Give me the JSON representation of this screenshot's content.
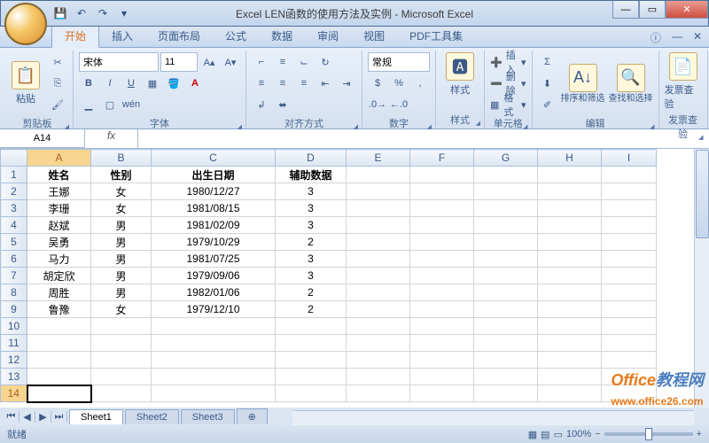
{
  "window": {
    "title": "Excel LEN函数的使用方法及实例 - Microsoft Excel"
  },
  "tabs": [
    "开始",
    "插入",
    "页面布局",
    "公式",
    "数据",
    "审阅",
    "视图",
    "PDF工具集"
  ],
  "active_tab_index": 0,
  "ribbon": {
    "clipboard": {
      "paste": "粘贴",
      "label": "剪贴板"
    },
    "font": {
      "name": "宋体",
      "size": "11",
      "label": "字体"
    },
    "align": {
      "label": "对齐方式"
    },
    "number": {
      "format": "常规",
      "label": "数字"
    },
    "styles": {
      "label": "样式",
      "btn": "样式"
    },
    "cells": {
      "insert": "插入",
      "delete": "删除",
      "format": "格式",
      "label": "单元格"
    },
    "editing": {
      "sort": "排序和筛选",
      "find": "查找和选择",
      "label": "编辑"
    },
    "invoice": {
      "btn": "发票查验",
      "label": "发票查验"
    }
  },
  "name_box": "A14",
  "formula": "",
  "columns": [
    "A",
    "B",
    "C",
    "D",
    "E",
    "F",
    "G",
    "H",
    "I"
  ],
  "rows": [
    {
      "n": 1,
      "A": "姓名",
      "B": "性别",
      "C": "出生日期",
      "D": "辅助数据",
      "bold": true
    },
    {
      "n": 2,
      "A": "王娜",
      "B": "女",
      "C": "1980/12/27",
      "D": "3"
    },
    {
      "n": 3,
      "A": "李珊",
      "B": "女",
      "C": "1981/08/15",
      "D": "3"
    },
    {
      "n": 4,
      "A": "赵斌",
      "B": "男",
      "C": "1981/02/09",
      "D": "3"
    },
    {
      "n": 5,
      "A": "吴勇",
      "B": "男",
      "C": "1979/10/29",
      "D": "2"
    },
    {
      "n": 6,
      "A": "马力",
      "B": "男",
      "C": "1981/07/25",
      "D": "3"
    },
    {
      "n": 7,
      "A": "胡定欣",
      "B": "男",
      "C": "1979/09/06",
      "D": "3"
    },
    {
      "n": 8,
      "A": "周胜",
      "B": "男",
      "C": "1982/01/06",
      "D": "2"
    },
    {
      "n": 9,
      "A": "鲁豫",
      "B": "女",
      "C": "1979/12/10",
      "D": "2"
    },
    {
      "n": 10
    },
    {
      "n": 11
    },
    {
      "n": 12
    },
    {
      "n": 13
    },
    {
      "n": 14
    }
  ],
  "active_cell": "A14",
  "sheet_tabs": [
    "Sheet1",
    "Sheet2",
    "Sheet3"
  ],
  "active_sheet": 0,
  "status": {
    "ready": "就绪",
    "zoom": "100%"
  },
  "watermark": {
    "brand1": "Office",
    "brand2": "教程网",
    "url": "www.office26.com"
  }
}
